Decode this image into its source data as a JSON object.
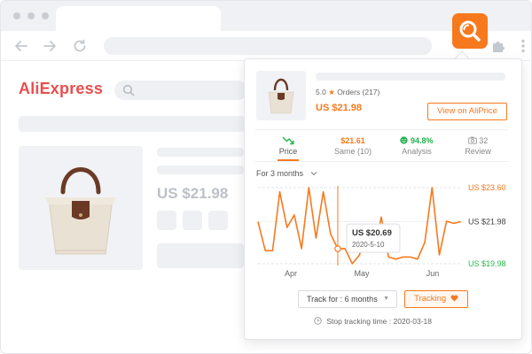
{
  "site": {
    "logo": "AliExpress",
    "product_price": "US $21.98"
  },
  "popup": {
    "rating": "5.0",
    "orders": "Orders (217)",
    "price": "US $21.98",
    "view_button": "View on AliPrice",
    "stats": [
      {
        "top_value": "",
        "label": "Price",
        "icon": "trend-down-icon",
        "active": true
      },
      {
        "top_value": "$21.61",
        "label": "Same (10)",
        "icon": "",
        "active": false
      },
      {
        "top_value": "94.8%",
        "label": "Analysis",
        "icon": "smile-icon",
        "active": false
      },
      {
        "top_value": "32",
        "label": "Review",
        "icon": "camera-icon",
        "active": false
      }
    ],
    "period": "For 3 months",
    "track_for": "Track for : 6 months",
    "tracking_button": "Tracking",
    "stop_label": "Stop tracking time :",
    "stop_date": "2020-03-18"
  },
  "colors": {
    "accent": "#f7791e",
    "logo": "#e94e4e",
    "min_price": "#2db84b",
    "analysis_green": "#22b14c"
  },
  "chart_data": {
    "type": "line",
    "x_ticks": [
      "Apr",
      "May",
      "Jun"
    ],
    "y_labels": {
      "max": "US $23.60",
      "current": "US $21.98",
      "min": "US $19.98"
    },
    "ylim": [
      19.98,
      23.6
    ],
    "series": [
      {
        "values": [
          21.98,
          20.6,
          20.6,
          23.4,
          21.7,
          22.3,
          20.7,
          23.6,
          21.2,
          23.4,
          21.4,
          20.69,
          20.7,
          19.98,
          20.4,
          21.8,
          20.6,
          22.2,
          20.3,
          20.2,
          20.3,
          20.3,
          20.2,
          21.0,
          23.6,
          20.4,
          22.0,
          21.9,
          21.98
        ]
      }
    ],
    "tooltip": {
      "price": "US $20.69",
      "date": "2020-5-10",
      "point_index": 11
    }
  }
}
